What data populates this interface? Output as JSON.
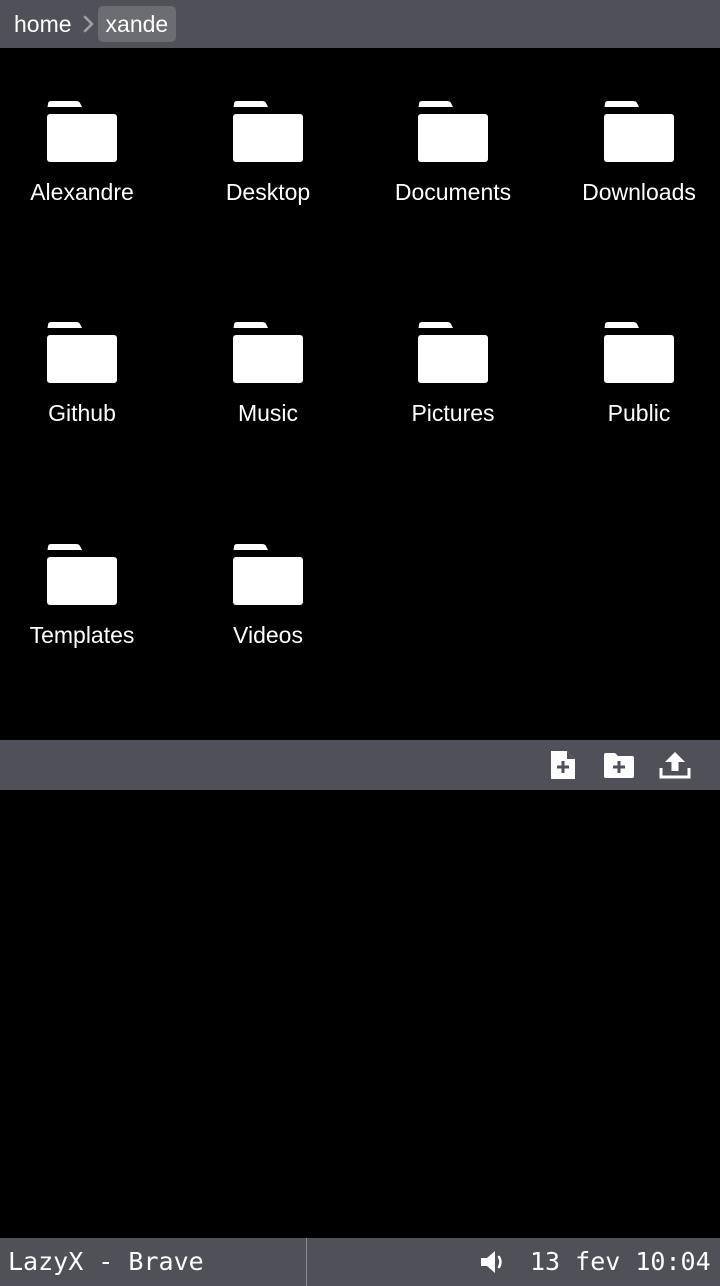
{
  "breadcrumb": {
    "items": [
      "home",
      "xande"
    ],
    "separator_icon": "chevron-right-icon"
  },
  "files": [
    {
      "name": "Alexandre",
      "icon": "folder-icon"
    },
    {
      "name": "Desktop",
      "icon": "folder-icon"
    },
    {
      "name": "Documents",
      "icon": "folder-icon"
    },
    {
      "name": "Downloads",
      "icon": "folder-icon"
    },
    {
      "name": "Github",
      "icon": "folder-icon"
    },
    {
      "name": "Music",
      "icon": "folder-icon"
    },
    {
      "name": "Pictures",
      "icon": "folder-icon"
    },
    {
      "name": "Public",
      "icon": "folder-icon"
    },
    {
      "name": "Templates",
      "icon": "folder-icon"
    },
    {
      "name": "Videos",
      "icon": "folder-icon"
    }
  ],
  "actions": [
    {
      "icon": "new-file-icon"
    },
    {
      "icon": "new-folder-icon"
    },
    {
      "icon": "upload-icon"
    }
  ],
  "taskbar": {
    "window_title": "LazyX - Brave",
    "volume_icon": "volume-icon",
    "clock": "13 fev 10:04"
  },
  "colors": {
    "bar_background": "#505158",
    "active_crumb": "#6c6d73",
    "content_background": "#000000",
    "icon": "#ffffff"
  }
}
